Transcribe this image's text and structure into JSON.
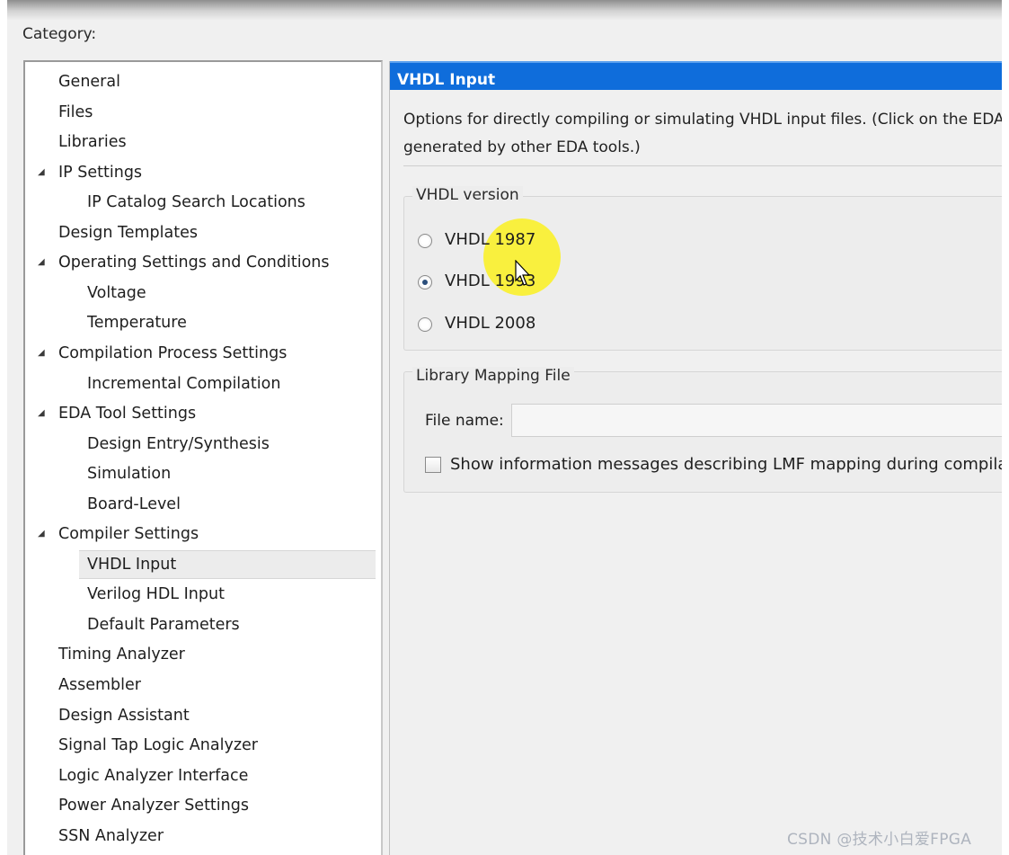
{
  "dialog": {
    "category_label": "Category:"
  },
  "tree": {
    "items": [
      {
        "label": "General",
        "level": 0
      },
      {
        "label": "Files",
        "level": 0
      },
      {
        "label": "Libraries",
        "level": 0
      },
      {
        "label": "IP Settings",
        "level": 0,
        "expanded": true
      },
      {
        "label": "IP Catalog Search Locations",
        "level": 1
      },
      {
        "label": "Design Templates",
        "level": 0
      },
      {
        "label": "Operating Settings and Conditions",
        "level": 0,
        "expanded": true
      },
      {
        "label": "Voltage",
        "level": 1
      },
      {
        "label": "Temperature",
        "level": 1
      },
      {
        "label": "Compilation Process Settings",
        "level": 0,
        "expanded": true
      },
      {
        "label": "Incremental Compilation",
        "level": 1
      },
      {
        "label": "EDA Tool Settings",
        "level": 0,
        "expanded": true
      },
      {
        "label": "Design Entry/Synthesis",
        "level": 1
      },
      {
        "label": "Simulation",
        "level": 1
      },
      {
        "label": "Board-Level",
        "level": 1
      },
      {
        "label": "Compiler Settings",
        "level": 0,
        "expanded": true
      },
      {
        "label": "VHDL Input",
        "level": 1,
        "selected": true
      },
      {
        "label": "Verilog HDL Input",
        "level": 1
      },
      {
        "label": "Default Parameters",
        "level": 1
      },
      {
        "label": "Timing Analyzer",
        "level": 0
      },
      {
        "label": "Assembler",
        "level": 0
      },
      {
        "label": "Design Assistant",
        "level": 0
      },
      {
        "label": "Signal Tap Logic Analyzer",
        "level": 0
      },
      {
        "label": "Logic Analyzer Interface",
        "level": 0
      },
      {
        "label": "Power Analyzer Settings",
        "level": 0
      },
      {
        "label": "SSN Analyzer",
        "level": 0
      }
    ],
    "expander_glyph": "◢"
  },
  "panel": {
    "title": "VHDL Input",
    "description_line1": "Options for directly compiling or simulating VHDL input files.  (Click on the EDA",
    "description_line2": "generated by other EDA tools.)",
    "vhdl_version": {
      "group_title": "VHDL version",
      "options": [
        {
          "label": "VHDL 1987",
          "checked": false
        },
        {
          "label": "VHDL 1993",
          "checked": true
        },
        {
          "label": "VHDL 2008",
          "checked": false
        }
      ]
    },
    "library_mapping": {
      "group_title": "Library Mapping File",
      "file_name_label": "File name:",
      "file_name_value": "",
      "show_messages_label": "Show information messages describing LMF mapping during compilation",
      "show_messages_checked": false
    }
  },
  "watermark": "CSDN @技术小白爱FPGA",
  "colors": {
    "title_bar": "#0f6ddb",
    "highlight": "#faf01e"
  }
}
